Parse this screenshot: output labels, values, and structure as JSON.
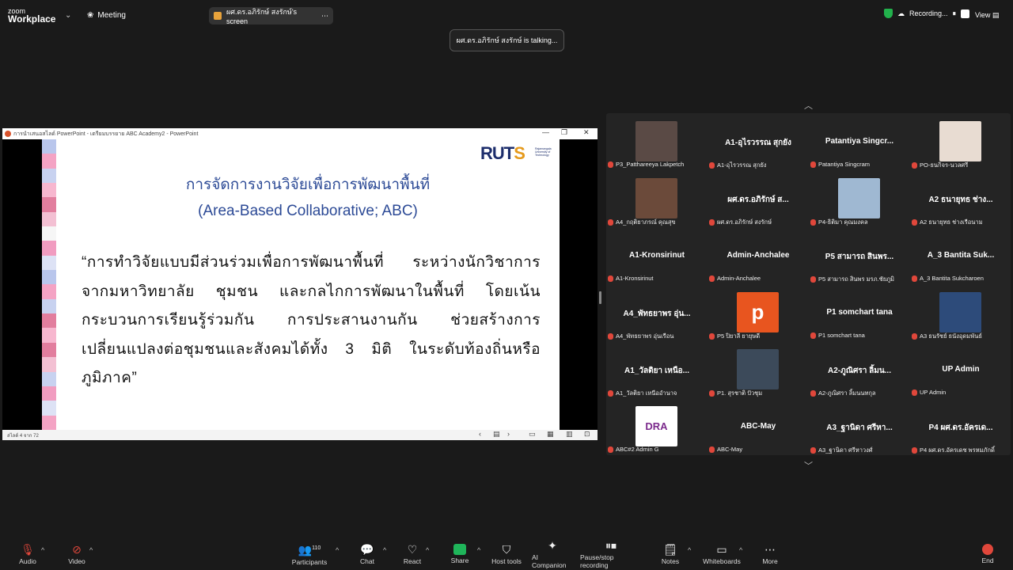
{
  "header": {
    "logo_line1": "zoom",
    "logo_line2": "Workplace",
    "meeting_label": "Meeting",
    "share_label": "ผศ.ดร.อภิรักษ์ สงรักษ์'s screen",
    "recording_label": "Recording...",
    "view_label": "View",
    "talking": "ผศ.ดร.อภิรักษ์ สงรักษ์ is talking..."
  },
  "presentation": {
    "window_title": "การนำเสนอสไลด์ PowerPoint - เตรียมบรรยาย ABC Academy2 - PowerPoint",
    "logo_text": "RUTS",
    "logo_sub": "Rajamangala University of Technology",
    "title_line1": "การจัดการงานวิจัยเพื่อการพัฒนาพื้นที่",
    "title_line2": "(Area-Based Collaborative; ABC)",
    "body": "“การทำวิจัยแบบมีส่วนร่วมเพื่อการพัฒนาพื้นที่ ระหว่างนักวิชาการจากมหาวิทยาลัย ชุมชน และกลไกการพัฒนาในพื้นที่ โดยเน้นกระบวนการเรียนรู้ร่วมกัน การประสานงานกัน ช่วยสร้างการเปลี่ยนแปลงต่อชุมชนและสังคมได้ทั้ง 3 มิติ ในระดับท้องถิ่นหรือภูมิภาค”",
    "slide_status": "สไลด์ 4 จาก 72"
  },
  "participants": [
    {
      "name": "",
      "label": "P3_Patthareeya Lakpetch",
      "thumb": "#5a4a45"
    },
    {
      "name": "A1-อุไรวรรณ สุกยัง",
      "label": "A1-อุไรวรรณ สุกยัง",
      "thumb": ""
    },
    {
      "name": "Patantiya  Singcr...",
      "label": "Patantiya Singcram",
      "thumb": ""
    },
    {
      "name": "",
      "label": "PO-ธนกิจร-นวลศรี",
      "thumb": "#e8dcd2"
    },
    {
      "name": "",
      "label": "A4_กฤติยาภรณ์ คุณสุข",
      "thumb": "#6b4a3a"
    },
    {
      "name": "ผศ.ดร.อภิรักษ์  ส...",
      "label": "ผศ.ดร.อภิรักษ์ สงรักษ์",
      "thumb": ""
    },
    {
      "name": "",
      "label": "P4-ธิติมา คุณมงคล",
      "thumb": "#9fb8d2"
    },
    {
      "name": "A2 ธนายุทธ ช่าง...",
      "label": "A2 ธนายุทธ ช่างเรือนาม",
      "thumb": ""
    },
    {
      "name": "A1-Kronsirinut",
      "label": "A1-Kronsirinut",
      "thumb": ""
    },
    {
      "name": "Admin-Anchalee",
      "label": "Admin-Anchalee",
      "thumb": ""
    },
    {
      "name": "P5 สามารถ สินพร...",
      "label": "P5 สามารถ สินพร มรภ.ชัยภูมิ",
      "thumb": ""
    },
    {
      "name": "A_3 Bantita Suk...",
      "label": "A_3 Bantita Sukcharoen",
      "thumb": ""
    },
    {
      "name": "A4_พัทธยาพร อุ่น...",
      "label": "A4_พัทธยาพร อุ่นเรือน",
      "thumb": ""
    },
    {
      "name": "",
      "label": "P5 ปิยาลี ยายุษดี",
      "thumb": "#e8551f",
      "letter": "p"
    },
    {
      "name": "P1 somchart tana",
      "label": "P1 somchart tana",
      "thumb": ""
    },
    {
      "name": "",
      "label": "A3 ธนรัชย์ ธนังอุดมพันธ์",
      "thumb": "#2d4b7a"
    },
    {
      "name": "A1_วัลติยา เหนือ...",
      "label": "A1_วัลติยา เหนืออำนาจ",
      "thumb": ""
    },
    {
      "name": "",
      "label": "P1. สุรชาติ ปัวชุม",
      "thumb": "#3c4a5a"
    },
    {
      "name": "A2-ภูณิศรา ลิ้มน...",
      "label": "A2-ภูณิศรา ลิ้มนนทกุล",
      "thumb": ""
    },
    {
      "name": "UP Admin",
      "label": "UP Admin",
      "thumb": ""
    },
    {
      "name": "",
      "label": "ABC#2 Admin G",
      "thumb": "#ffffff",
      "letter": "DRA"
    },
    {
      "name": "ABC-May",
      "label": "ABC-May",
      "thumb": ""
    },
    {
      "name": "A3_ฐานิดา ศรีหา...",
      "label": "A3_ฐานิดา ศรีหาวงศ์",
      "thumb": ""
    },
    {
      "name": "P4 ผศ.ดร.อัครเด...",
      "label": "P4 ผศ.ดร.อัครเดช พรหมภักดิ์",
      "thumb": ""
    }
  ],
  "toolbar": {
    "audio": "Audio",
    "video": "Video",
    "participants": "Participants",
    "participants_count": "110",
    "chat": "Chat",
    "react": "React",
    "share": "Share",
    "host_tools": "Host tools",
    "ai_companion": "AI Companion",
    "pause_recording": "Pause/stop recording",
    "notes": "Notes",
    "whiteboards": "Whiteboards",
    "more": "More",
    "end": "End"
  },
  "colors": {
    "accent_blue": "#2c4a96",
    "mute_red": "#e0473b",
    "share_green": "#1fb55a",
    "logo_orange": "#e59a1c"
  }
}
